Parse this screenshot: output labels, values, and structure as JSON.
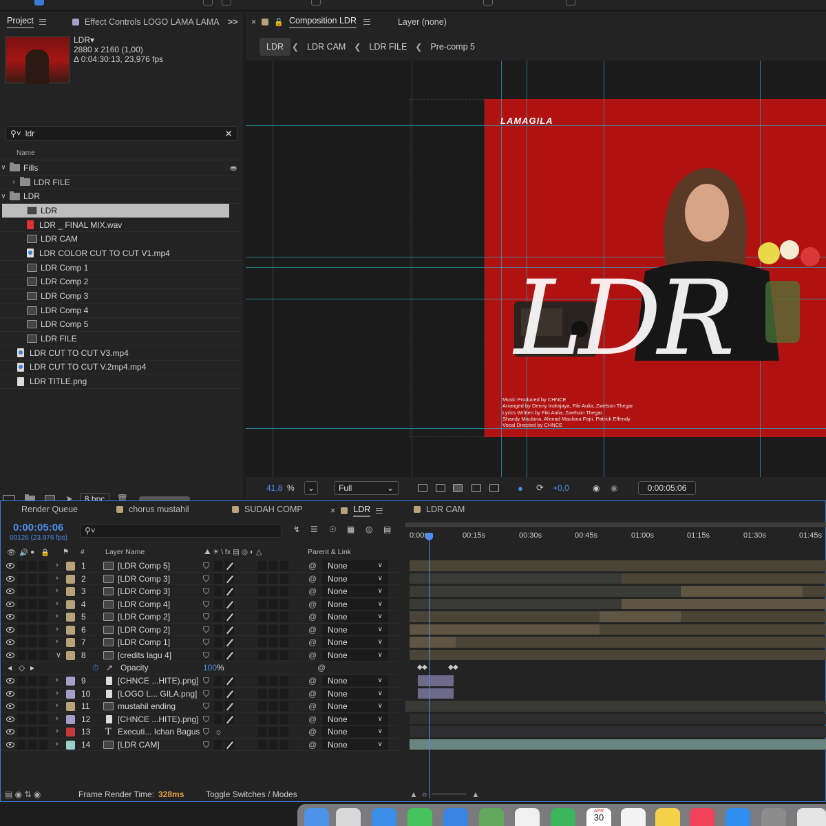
{
  "project": {
    "tabs": [
      {
        "label": "Project"
      },
      {
        "label": "Effect Controls LOGO LAMA LAMA G"
      }
    ],
    "expand_glyph": ">>",
    "info": {
      "name": "LDR▾",
      "dims": "2880 x 2160 (1,00)",
      "duration": "Δ 0:04:30:13, 23,976 fps"
    },
    "search_value": "ldr",
    "column_name": "Name",
    "items": [
      {
        "label": "Fills",
        "kind": "folder",
        "level": 0,
        "open": true
      },
      {
        "label": "LDR FILE",
        "kind": "folder",
        "level": 1,
        "open": false
      },
      {
        "label": "LDR",
        "kind": "folder",
        "level": 0,
        "open": true
      },
      {
        "label": "LDR",
        "kind": "comp",
        "level": 2,
        "selected": true
      },
      {
        "label": "LDR _ FINAL MIX.wav",
        "kind": "audio",
        "level": 2
      },
      {
        "label": "LDR CAM",
        "kind": "comp",
        "level": 2
      },
      {
        "label": "LDR COLOR CUT TO CUT V1.mp4",
        "kind": "video",
        "level": 2
      },
      {
        "label": "LDR Comp 1",
        "kind": "comp",
        "level": 2
      },
      {
        "label": "LDR Comp 2",
        "kind": "comp",
        "level": 2
      },
      {
        "label": "LDR Comp 3",
        "kind": "comp",
        "level": 2
      },
      {
        "label": "LDR Comp 4",
        "kind": "comp",
        "level": 2
      },
      {
        "label": "LDR Comp 5",
        "kind": "comp",
        "level": 2
      },
      {
        "label": "LDR FILE",
        "kind": "comp",
        "level": 2
      },
      {
        "label": "LDR CUT TO CUT V3.mp4",
        "kind": "video",
        "level": 1
      },
      {
        "label": "LDR CUT TO CUT V.2mp4.mp4",
        "kind": "video",
        "level": 1
      },
      {
        "label": "LDR TITLE.png",
        "kind": "file",
        "level": 1
      }
    ],
    "bpc": "8 bpc"
  },
  "composition": {
    "tab_label": "Composition LDR",
    "layer_label": "Layer (none)",
    "breadcrumbs": [
      "LDR",
      "LDR CAM",
      "LDR FILE",
      "Pre-comp 5"
    ],
    "logo_text": "LAMAGILA",
    "script_text": "LDR",
    "credits": [
      "Music Produced by CHNCE",
      "Arranged by Denny Indrajaya, Fiki Aulia, Zwelson Thegar",
      "Lyrics Written by Fiki Aulia, Zwelson Thegar",
      "Shandy Maulana, Ahmad Maulana Fajri, Patrick Effendy",
      "Vocal Directed by CHNCE"
    ],
    "zoom": "41,8",
    "zoom_unit": "%",
    "resolution": "Full",
    "exposure": "+0,0",
    "current_time": "0:00:05:06"
  },
  "timeline": {
    "tabs": [
      "Render Queue",
      "chorus mustahil",
      "SUDAH COMP",
      "LDR",
      "LDR CAM"
    ],
    "timecode": "0:00:05:06",
    "frames": "00126 (23.976 fps)",
    "ruler": [
      "0:00s",
      "00:15s",
      "00:30s",
      "00:45s",
      "01:00s",
      "01:15s",
      "01:30s",
      "01:45s"
    ],
    "col_hash": "#",
    "col_layer_name": "Layer Name",
    "col_parent": "Parent & Link",
    "layers": [
      {
        "num": "1",
        "name": "[LDR Comp 5]",
        "color": "#b8a27a",
        "parent": "None"
      },
      {
        "num": "2",
        "name": "[LDR Comp 3]",
        "color": "#b8a27a",
        "parent": "None"
      },
      {
        "num": "3",
        "name": "[LDR Comp 3]",
        "color": "#b8a27a",
        "parent": "None"
      },
      {
        "num": "4",
        "name": "[LDR Comp 4]",
        "color": "#b8a27a",
        "parent": "None"
      },
      {
        "num": "5",
        "name": "[LDR Comp 2]",
        "color": "#b8a27a",
        "parent": "None"
      },
      {
        "num": "6",
        "name": "[LDR Comp 2]",
        "color": "#b8a27a",
        "parent": "None"
      },
      {
        "num": "7",
        "name": "[LDR Comp 1]",
        "color": "#b8a27a",
        "parent": "None"
      },
      {
        "num": "8",
        "name": "[credits lagu 4]",
        "color": "#b8a27a",
        "parent": "None"
      },
      {
        "num": "9",
        "name": "[CHNCE ...HITE).png]",
        "color": "#a4a0c8",
        "parent": "None"
      },
      {
        "num": "10",
        "name": "[LOGO L... GILA.png]",
        "color": "#a4a0c8",
        "parent": "None"
      },
      {
        "num": "11",
        "name": "mustahil ending",
        "color": "#b8a27a",
        "parent": "None"
      },
      {
        "num": "12",
        "name": "[CHNCE ...HITE).png]",
        "color": "#a4a0c8",
        "parent": "None"
      },
      {
        "num": "13",
        "name": "Executi... Ichan Bagus",
        "color": "#c83a3a",
        "parent": "None"
      },
      {
        "num": "14",
        "name": "[LDR CAM]",
        "color": "#9ad0c8",
        "parent": "None"
      }
    ],
    "opacity_label": "Opacity",
    "opacity_value": "100",
    "opacity_unit": "%",
    "frame_render_label": "Frame Render Time:",
    "frame_render_value": "328ms",
    "toggle_label": "Toggle Switches / Modes"
  },
  "dock": {
    "calendar_month": "APR",
    "calendar_day": "30"
  },
  "colors": {
    "accent": "#4d8ef0",
    "guide": "#2aa3b5",
    "comp_label": "#b8a27a",
    "render_time": "#e0a040"
  }
}
